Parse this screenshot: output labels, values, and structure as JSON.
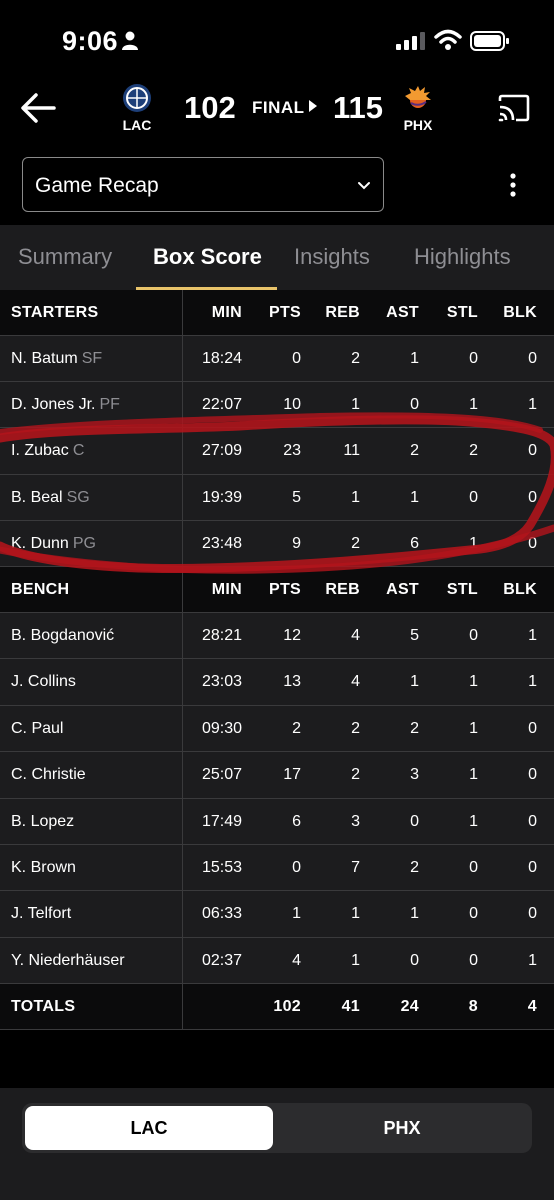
{
  "status_bar": {
    "time": "9:06"
  },
  "header": {
    "away": {
      "abbr": "LAC",
      "score": "102"
    },
    "home": {
      "abbr": "PHX",
      "score": "115"
    },
    "status": "FINAL"
  },
  "dropdown": {
    "value": "Game Recap"
  },
  "tabs": [
    {
      "label": "Summary"
    },
    {
      "label": "Box Score"
    },
    {
      "label": "Insights"
    },
    {
      "label": "Highlights"
    }
  ],
  "columns": [
    "MIN",
    "PTS",
    "REB",
    "AST",
    "STL",
    "BLK"
  ],
  "starters_label": "STARTERS",
  "bench_label": "BENCH",
  "totals_label": "TOTALS",
  "starters": [
    {
      "name": "N. Batum",
      "pos": "SF",
      "min": "18:24",
      "pts": "0",
      "reb": "2",
      "ast": "1",
      "stl": "0",
      "blk": "0"
    },
    {
      "name": "D. Jones Jr.",
      "pos": "PF",
      "min": "22:07",
      "pts": "10",
      "reb": "1",
      "ast": "0",
      "stl": "1",
      "blk": "1"
    },
    {
      "name": "I. Zubac",
      "pos": "C",
      "min": "27:09",
      "pts": "23",
      "reb": "11",
      "ast": "2",
      "stl": "2",
      "blk": "0"
    },
    {
      "name": "B. Beal",
      "pos": "SG",
      "min": "19:39",
      "pts": "5",
      "reb": "1",
      "ast": "1",
      "stl": "0",
      "blk": "0"
    },
    {
      "name": "K. Dunn",
      "pos": "PG",
      "min": "23:48",
      "pts": "9",
      "reb": "2",
      "ast": "6",
      "stl": "1",
      "blk": "0"
    }
  ],
  "bench": [
    {
      "name": "B. Bogdanović",
      "min": "28:21",
      "pts": "12",
      "reb": "4",
      "ast": "5",
      "stl": "0",
      "blk": "1"
    },
    {
      "name": "J. Collins",
      "min": "23:03",
      "pts": "13",
      "reb": "4",
      "ast": "1",
      "stl": "1",
      "blk": "1"
    },
    {
      "name": "C. Paul",
      "min": "09:30",
      "pts": "2",
      "reb": "2",
      "ast": "2",
      "stl": "1",
      "blk": "0"
    },
    {
      "name": "C. Christie",
      "min": "25:07",
      "pts": "17",
      "reb": "2",
      "ast": "3",
      "stl": "1",
      "blk": "0"
    },
    {
      "name": "B. Lopez",
      "min": "17:49",
      "pts": "6",
      "reb": "3",
      "ast": "0",
      "stl": "1",
      "blk": "0"
    },
    {
      "name": "K. Brown",
      "min": "15:53",
      "pts": "0",
      "reb": "7",
      "ast": "2",
      "stl": "0",
      "blk": "0"
    },
    {
      "name": "J. Telfort",
      "min": "06:33",
      "pts": "1",
      "reb": "1",
      "ast": "1",
      "stl": "0",
      "blk": "0"
    },
    {
      "name": "Y. Niederhäuser",
      "min": "02:37",
      "pts": "4",
      "reb": "1",
      "ast": "0",
      "stl": "0",
      "blk": "1"
    }
  ],
  "totals": {
    "pts": "102",
    "reb": "41",
    "ast": "24",
    "stl": "8",
    "blk": "4"
  },
  "team_toggle": {
    "left": "LAC",
    "right": "PHX"
  },
  "colors": {
    "accent": "#e8c36a",
    "annotation": "#b3141b"
  }
}
